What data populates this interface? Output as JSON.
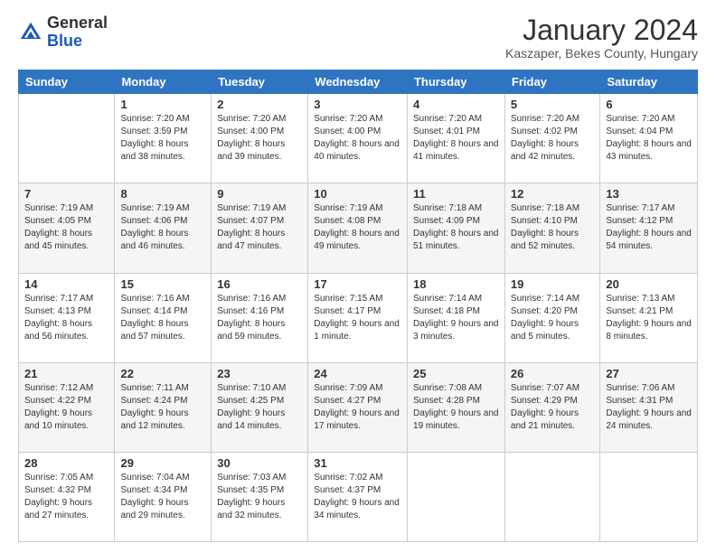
{
  "header": {
    "logo_general": "General",
    "logo_blue": "Blue",
    "title": "January 2024",
    "subtitle": "Kaszaper, Bekes County, Hungary"
  },
  "weekdays": [
    "Sunday",
    "Monday",
    "Tuesday",
    "Wednesday",
    "Thursday",
    "Friday",
    "Saturday"
  ],
  "weeks": [
    [
      {
        "day": "",
        "sunrise": "",
        "sunset": "",
        "daylight": ""
      },
      {
        "day": "1",
        "sunrise": "Sunrise: 7:20 AM",
        "sunset": "Sunset: 3:59 PM",
        "daylight": "Daylight: 8 hours and 38 minutes."
      },
      {
        "day": "2",
        "sunrise": "Sunrise: 7:20 AM",
        "sunset": "Sunset: 4:00 PM",
        "daylight": "Daylight: 8 hours and 39 minutes."
      },
      {
        "day": "3",
        "sunrise": "Sunrise: 7:20 AM",
        "sunset": "Sunset: 4:00 PM",
        "daylight": "Daylight: 8 hours and 40 minutes."
      },
      {
        "day": "4",
        "sunrise": "Sunrise: 7:20 AM",
        "sunset": "Sunset: 4:01 PM",
        "daylight": "Daylight: 8 hours and 41 minutes."
      },
      {
        "day": "5",
        "sunrise": "Sunrise: 7:20 AM",
        "sunset": "Sunset: 4:02 PM",
        "daylight": "Daylight: 8 hours and 42 minutes."
      },
      {
        "day": "6",
        "sunrise": "Sunrise: 7:20 AM",
        "sunset": "Sunset: 4:04 PM",
        "daylight": "Daylight: 8 hours and 43 minutes."
      }
    ],
    [
      {
        "day": "7",
        "sunrise": "Sunrise: 7:19 AM",
        "sunset": "Sunset: 4:05 PM",
        "daylight": "Daylight: 8 hours and 45 minutes."
      },
      {
        "day": "8",
        "sunrise": "Sunrise: 7:19 AM",
        "sunset": "Sunset: 4:06 PM",
        "daylight": "Daylight: 8 hours and 46 minutes."
      },
      {
        "day": "9",
        "sunrise": "Sunrise: 7:19 AM",
        "sunset": "Sunset: 4:07 PM",
        "daylight": "Daylight: 8 hours and 47 minutes."
      },
      {
        "day": "10",
        "sunrise": "Sunrise: 7:19 AM",
        "sunset": "Sunset: 4:08 PM",
        "daylight": "Daylight: 8 hours and 49 minutes."
      },
      {
        "day": "11",
        "sunrise": "Sunrise: 7:18 AM",
        "sunset": "Sunset: 4:09 PM",
        "daylight": "Daylight: 8 hours and 51 minutes."
      },
      {
        "day": "12",
        "sunrise": "Sunrise: 7:18 AM",
        "sunset": "Sunset: 4:10 PM",
        "daylight": "Daylight: 8 hours and 52 minutes."
      },
      {
        "day": "13",
        "sunrise": "Sunrise: 7:17 AM",
        "sunset": "Sunset: 4:12 PM",
        "daylight": "Daylight: 8 hours and 54 minutes."
      }
    ],
    [
      {
        "day": "14",
        "sunrise": "Sunrise: 7:17 AM",
        "sunset": "Sunset: 4:13 PM",
        "daylight": "Daylight: 8 hours and 56 minutes."
      },
      {
        "day": "15",
        "sunrise": "Sunrise: 7:16 AM",
        "sunset": "Sunset: 4:14 PM",
        "daylight": "Daylight: 8 hours and 57 minutes."
      },
      {
        "day": "16",
        "sunrise": "Sunrise: 7:16 AM",
        "sunset": "Sunset: 4:16 PM",
        "daylight": "Daylight: 8 hours and 59 minutes."
      },
      {
        "day": "17",
        "sunrise": "Sunrise: 7:15 AM",
        "sunset": "Sunset: 4:17 PM",
        "daylight": "Daylight: 9 hours and 1 minute."
      },
      {
        "day": "18",
        "sunrise": "Sunrise: 7:14 AM",
        "sunset": "Sunset: 4:18 PM",
        "daylight": "Daylight: 9 hours and 3 minutes."
      },
      {
        "day": "19",
        "sunrise": "Sunrise: 7:14 AM",
        "sunset": "Sunset: 4:20 PM",
        "daylight": "Daylight: 9 hours and 5 minutes."
      },
      {
        "day": "20",
        "sunrise": "Sunrise: 7:13 AM",
        "sunset": "Sunset: 4:21 PM",
        "daylight": "Daylight: 9 hours and 8 minutes."
      }
    ],
    [
      {
        "day": "21",
        "sunrise": "Sunrise: 7:12 AM",
        "sunset": "Sunset: 4:22 PM",
        "daylight": "Daylight: 9 hours and 10 minutes."
      },
      {
        "day": "22",
        "sunrise": "Sunrise: 7:11 AM",
        "sunset": "Sunset: 4:24 PM",
        "daylight": "Daylight: 9 hours and 12 minutes."
      },
      {
        "day": "23",
        "sunrise": "Sunrise: 7:10 AM",
        "sunset": "Sunset: 4:25 PM",
        "daylight": "Daylight: 9 hours and 14 minutes."
      },
      {
        "day": "24",
        "sunrise": "Sunrise: 7:09 AM",
        "sunset": "Sunset: 4:27 PM",
        "daylight": "Daylight: 9 hours and 17 minutes."
      },
      {
        "day": "25",
        "sunrise": "Sunrise: 7:08 AM",
        "sunset": "Sunset: 4:28 PM",
        "daylight": "Daylight: 9 hours and 19 minutes."
      },
      {
        "day": "26",
        "sunrise": "Sunrise: 7:07 AM",
        "sunset": "Sunset: 4:29 PM",
        "daylight": "Daylight: 9 hours and 21 minutes."
      },
      {
        "day": "27",
        "sunrise": "Sunrise: 7:06 AM",
        "sunset": "Sunset: 4:31 PM",
        "daylight": "Daylight: 9 hours and 24 minutes."
      }
    ],
    [
      {
        "day": "28",
        "sunrise": "Sunrise: 7:05 AM",
        "sunset": "Sunset: 4:32 PM",
        "daylight": "Daylight: 9 hours and 27 minutes."
      },
      {
        "day": "29",
        "sunrise": "Sunrise: 7:04 AM",
        "sunset": "Sunset: 4:34 PM",
        "daylight": "Daylight: 9 hours and 29 minutes."
      },
      {
        "day": "30",
        "sunrise": "Sunrise: 7:03 AM",
        "sunset": "Sunset: 4:35 PM",
        "daylight": "Daylight: 9 hours and 32 minutes."
      },
      {
        "day": "31",
        "sunrise": "Sunrise: 7:02 AM",
        "sunset": "Sunset: 4:37 PM",
        "daylight": "Daylight: 9 hours and 34 minutes."
      },
      {
        "day": "",
        "sunrise": "",
        "sunset": "",
        "daylight": ""
      },
      {
        "day": "",
        "sunrise": "",
        "sunset": "",
        "daylight": ""
      },
      {
        "day": "",
        "sunrise": "",
        "sunset": "",
        "daylight": ""
      }
    ]
  ]
}
